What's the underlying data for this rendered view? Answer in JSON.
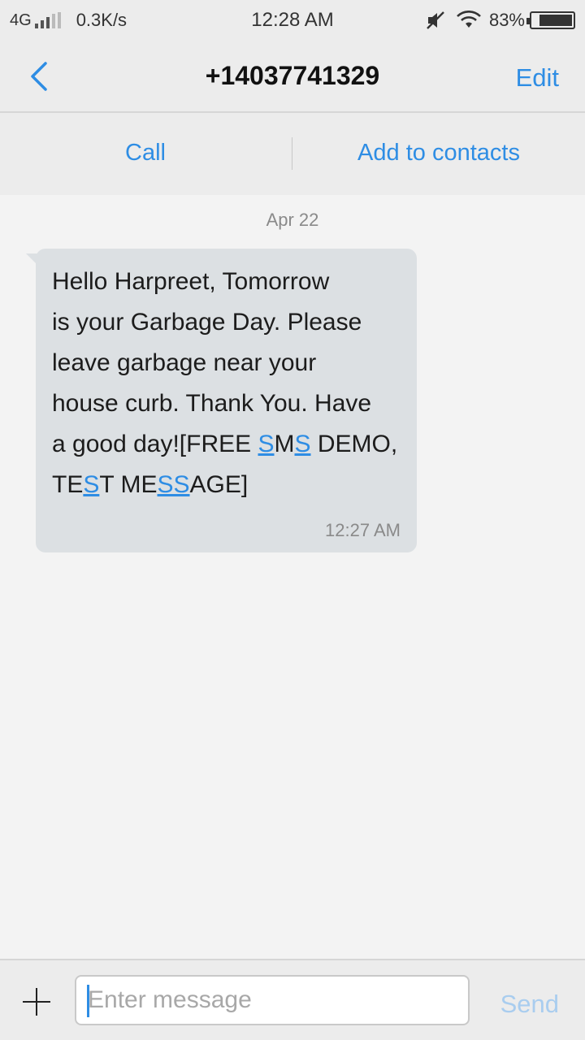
{
  "status_bar": {
    "network": "4G",
    "speed": "0.3K/s",
    "time": "12:28 AM",
    "battery": "83%",
    "battery_level": 0.83
  },
  "header": {
    "title": "+14037741329",
    "edit_label": "Edit"
  },
  "actions": {
    "call_label": "Call",
    "add_contact_label": "Add to contacts"
  },
  "conversation": {
    "date": "Apr 22",
    "message": {
      "line1": "Hello Harpreet, Tomorrow",
      "line2": "is your Garbage Day. Please",
      "line3": "leave garbage near your",
      "line4": "house curb. Thank You. Have",
      "line5_a": "a good day![FREE ",
      "line5_link1": "S",
      "line5_b": "M",
      "line5_link2": "S",
      "line5_c": " DEMO,",
      "line6_a": "TE",
      "line6_link1": "S",
      "line6_b": "T ME",
      "line6_link2": "SS",
      "line6_c": "AGE]",
      "time": "12:27 AM"
    }
  },
  "composer": {
    "placeholder": "Enter message",
    "value": "",
    "send_label": "Send"
  },
  "colors": {
    "accent": "#2e8de4",
    "bubble": "#dce0e3",
    "send_disabled": "#a9cdef"
  }
}
